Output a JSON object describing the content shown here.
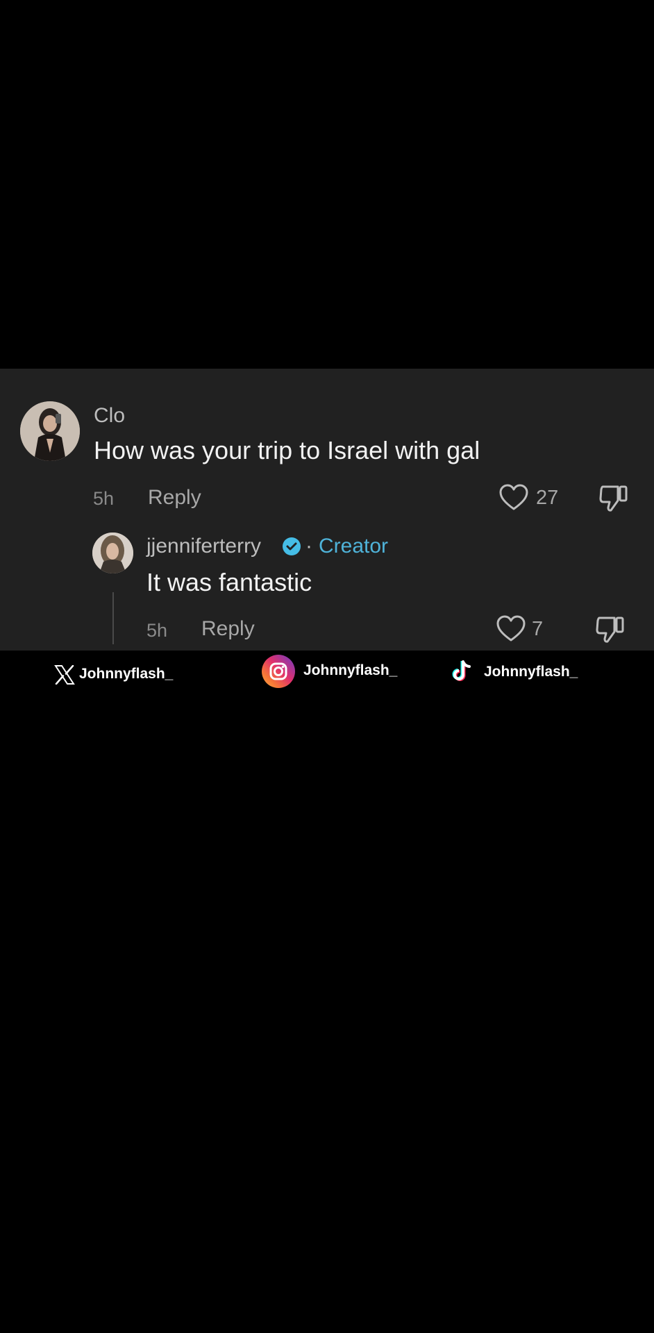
{
  "comment": {
    "username": "Clo",
    "text": "How was your trip to Israel with gal",
    "time": "5h",
    "reply_label": "Reply",
    "likes": "27"
  },
  "reply": {
    "username": "jjenniferterry",
    "separator": "·",
    "badge_label": "Creator",
    "text": "It was fantastic",
    "time": "5h",
    "reply_label": "Reply",
    "likes": "7"
  },
  "socials": [
    {
      "platform": "x",
      "icon": "x-logo-icon",
      "handle": "Johnnyflash_"
    },
    {
      "platform": "instagram",
      "icon": "instagram-logo-icon",
      "handle": "Johnnyflash_"
    },
    {
      "platform": "tiktok",
      "icon": "tiktok-logo-icon",
      "handle": "Johnnyflash_"
    }
  ],
  "colors": {
    "background": "#000000",
    "panel": "#212121",
    "creator_accent": "#4fb3d9",
    "verified_badge": "#45bde6"
  }
}
